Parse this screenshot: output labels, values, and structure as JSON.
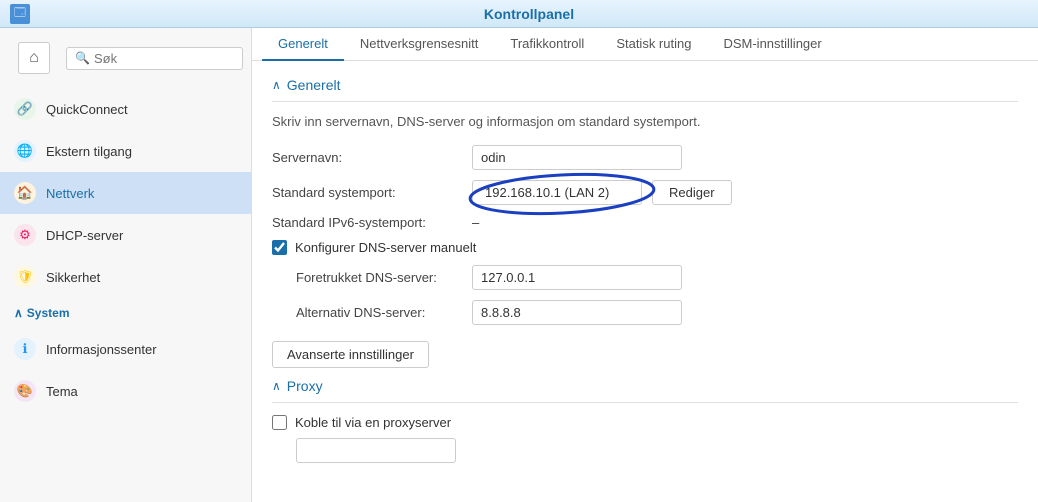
{
  "topbar": {
    "title": "Kontrollpanel",
    "icon": "🗔"
  },
  "sidebar": {
    "search_placeholder": "Søk",
    "items": [
      {
        "id": "quickconnect",
        "label": "QuickConnect",
        "icon": "🔗",
        "icon_class": "icon-quickconnect"
      },
      {
        "id": "ekstern",
        "label": "Ekstern tilgang",
        "icon": "🌐",
        "icon_class": "icon-extern"
      },
      {
        "id": "nettverk",
        "label": "Nettverk",
        "icon": "🏠",
        "icon_class": "icon-nettverk",
        "active": true
      },
      {
        "id": "dhcp",
        "label": "DHCP-server",
        "icon": "⚙",
        "icon_class": "icon-dhcp"
      },
      {
        "id": "sikkerhet",
        "label": "Sikkerhet",
        "icon": "🛡",
        "icon_class": "icon-sikkerhet"
      }
    ],
    "section_label": "System",
    "system_items": [
      {
        "id": "info",
        "label": "Informasjonssenter",
        "icon": "ℹ",
        "icon_class": "icon-info"
      },
      {
        "id": "tema",
        "label": "Tema",
        "icon": "🎨",
        "icon_class": "icon-tema"
      }
    ]
  },
  "tabs": [
    {
      "id": "generelt",
      "label": "Generelt",
      "active": true
    },
    {
      "id": "nettverksgrensesnitt",
      "label": "Nettverksgrensesnitt",
      "active": false
    },
    {
      "id": "trafikkontroll",
      "label": "Trafikkontroll",
      "active": false
    },
    {
      "id": "statisk_ruting",
      "label": "Statisk ruting",
      "active": false
    },
    {
      "id": "dsm_innstillinger",
      "label": "DSM-innstillinger",
      "active": false
    }
  ],
  "generelt_section": {
    "title": "Generelt",
    "description": "Skriv inn servernavn, DNS-server og informasjon om standard systemport.",
    "fields": {
      "servernavn_label": "Servernavn:",
      "servernavn_value": "odin",
      "systemport_label": "Standard systemport:",
      "systemport_value": "192.168.10.1 (LAN 2)",
      "rediger_label": "Rediger",
      "ipv6_label": "Standard IPv6-systemport:",
      "ipv6_value": "–",
      "dns_checkbox_label": "Konfigurer DNS-server manuelt",
      "foretrukket_dns_label": "Foretrukket DNS-server:",
      "foretrukket_dns_value": "127.0.0.1",
      "alternativ_dns_label": "Alternativ DNS-server:",
      "alternativ_dns_value": "8.8.8.8",
      "avanserte_btn_label": "Avanserte innstillinger"
    }
  },
  "proxy_section": {
    "title": "Proxy",
    "checkbox_label": "Koble til via en proxyserver"
  },
  "home_btn": "⌂"
}
